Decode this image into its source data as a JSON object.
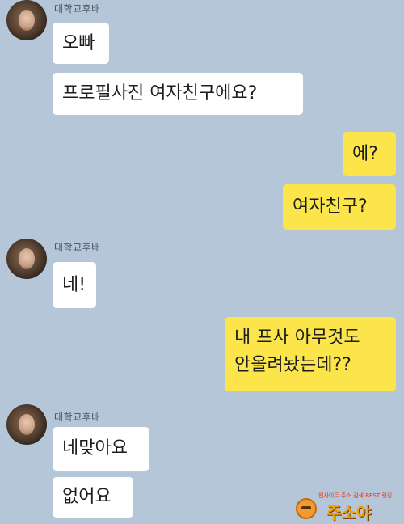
{
  "chat": {
    "sender_name": "대학교후배",
    "messages": [
      {
        "from": "other",
        "text": "오빠"
      },
      {
        "from": "other",
        "text": "프로필사진 여자친구에요?"
      },
      {
        "from": "me",
        "text": "에?"
      },
      {
        "from": "me",
        "text": "여자친구?"
      },
      {
        "from": "other",
        "text": "네!"
      },
      {
        "from": "me",
        "lines": [
          "내 프사 아무것도",
          "안올려놨는데??"
        ]
      },
      {
        "from": "other",
        "text": "네맞아요"
      },
      {
        "from": "other",
        "text": "없어요"
      }
    ]
  },
  "watermark": {
    "tagline": "웹사이트 주소 검색 BEST 랭킹",
    "brand": "주소야"
  },
  "colors": {
    "background": "#b4c6d8",
    "incoming_bubble": "#ffffff",
    "outgoing_bubble": "#fbe54b"
  }
}
